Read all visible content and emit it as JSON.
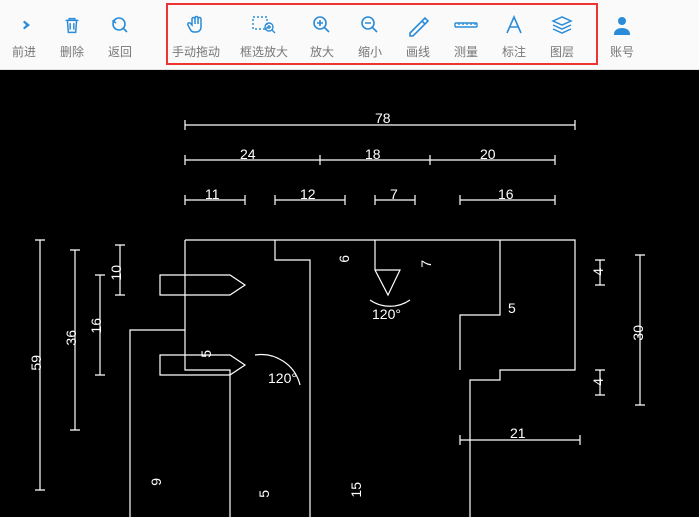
{
  "toolbar": {
    "forward": "前进",
    "delete": "删除",
    "back": "返回",
    "pan": "手动拖动",
    "zoom_box": "框选放大",
    "zoom_in": "放大",
    "zoom_out": "缩小",
    "line": "画线",
    "measure": "测量",
    "annotate": "标注",
    "layers": "图层",
    "account": "账号"
  },
  "dimensions": {
    "top_overall": "78",
    "row2_a": "24",
    "row2_b": "18",
    "row2_c": "20",
    "row3_a": "11",
    "row3_b": "12",
    "row3_c": "7",
    "row3_d": "16",
    "left_outer": "59",
    "left_mid": "36",
    "left_inner": "16",
    "left_top_small": "10",
    "left_small_5": "5",
    "notch_6": "6",
    "notch_7": "7",
    "right_span": "30",
    "right_4a": "4",
    "right_4b": "4",
    "right_small_5": "5",
    "bottom_21": "21",
    "bottom_9": "9",
    "bottom_5": "5",
    "bottom_15": "15",
    "angle_120a": "120°",
    "angle_120b": "120°"
  },
  "colors": {
    "toolbar_icon": "#2a8cd8",
    "highlight": "#e33",
    "canvas_bg": "#000000",
    "drawing_stroke": "#ffffff"
  }
}
